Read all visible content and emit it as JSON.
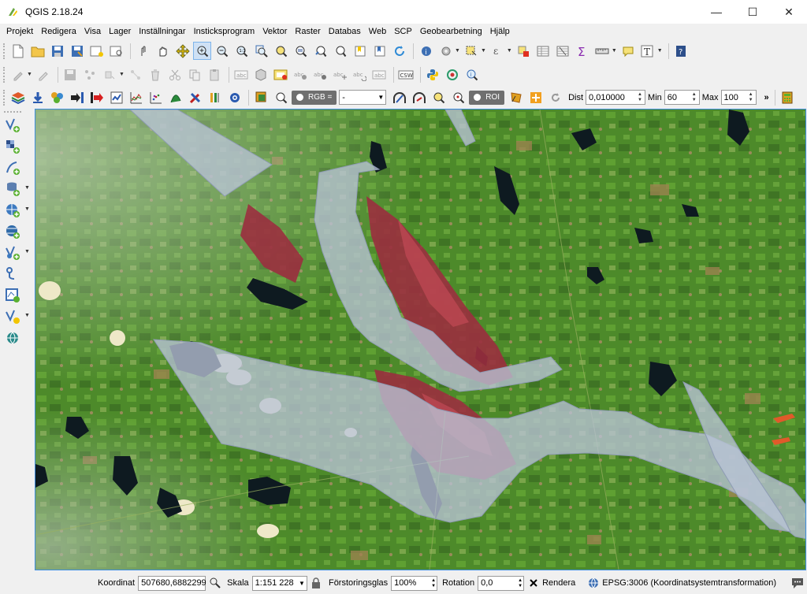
{
  "window": {
    "title": "QGIS 2.18.24",
    "minimize": "—",
    "maximize": "☐",
    "close": "✕"
  },
  "menu": [
    "Projekt",
    "Redigera",
    "Visa",
    "Lager",
    "Inställningar",
    "Insticksprogram",
    "Vektor",
    "Raster",
    "Databas",
    "Web",
    "SCP",
    "Geobearbetning",
    "Hjälp"
  ],
  "scp_toolbar": {
    "rgb_label": "RGB =",
    "rgb_value": "-",
    "roi_label": "ROI",
    "dist_label": "Dist",
    "dist_value": "0,010000",
    "min_label": "Min",
    "min_value": "60",
    "max_label": "Max",
    "max_value": "100",
    "overflow": "»"
  },
  "labels": {
    "csw": "CSW",
    "abc": "abc"
  },
  "statusbar": {
    "coord_label": "Koordinat",
    "coord_value": "507680,6882299",
    "scale_label": "Skala",
    "scale_value": "1:151 228",
    "magnifier_label": "Förstoringsglas",
    "magnifier_value": "100%",
    "rotation_label": "Rotation",
    "rotation_value": "0,0",
    "render_label": "Rendera",
    "crs_label": "EPSG:3006 (Koordinatsystemtransformation)"
  },
  "colors": {
    "accent": "#3e8ede",
    "vegetation": "#4f8a2a",
    "burn_scar": "#9b2f3f",
    "water": "#0f1a22",
    "river_overlay": "#b9c3d6"
  }
}
